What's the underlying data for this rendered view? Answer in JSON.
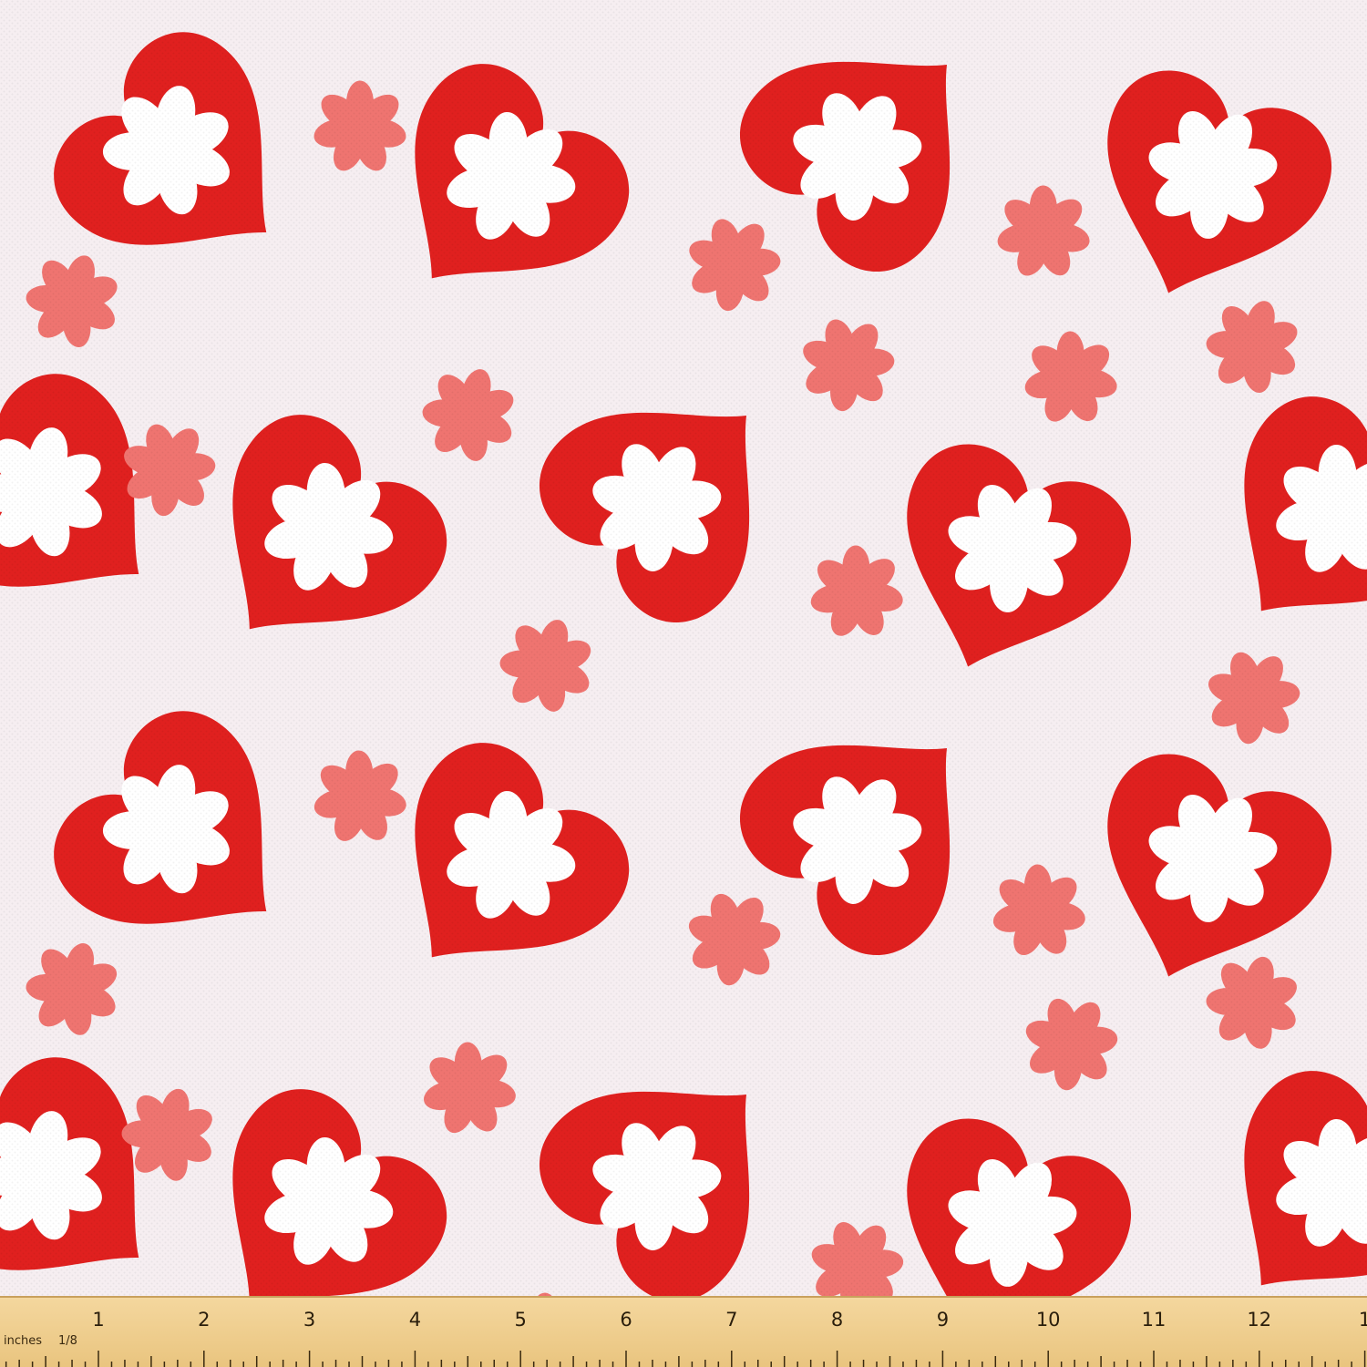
{
  "colors": {
    "background": "#f6eef1",
    "heart": "#e0201f",
    "heart_flower": "#ffffff",
    "small_flower": "#ef7470",
    "ruler": "#efcf8f",
    "ruler_text": "#2a1e0c"
  },
  "ruler": {
    "unit_label": "inches",
    "fraction_label": "1/8",
    "numbers": [
      "1",
      "2",
      "3",
      "4",
      "5",
      "6",
      "7",
      "8",
      "9",
      "10",
      "11",
      "12",
      "1"
    ]
  }
}
